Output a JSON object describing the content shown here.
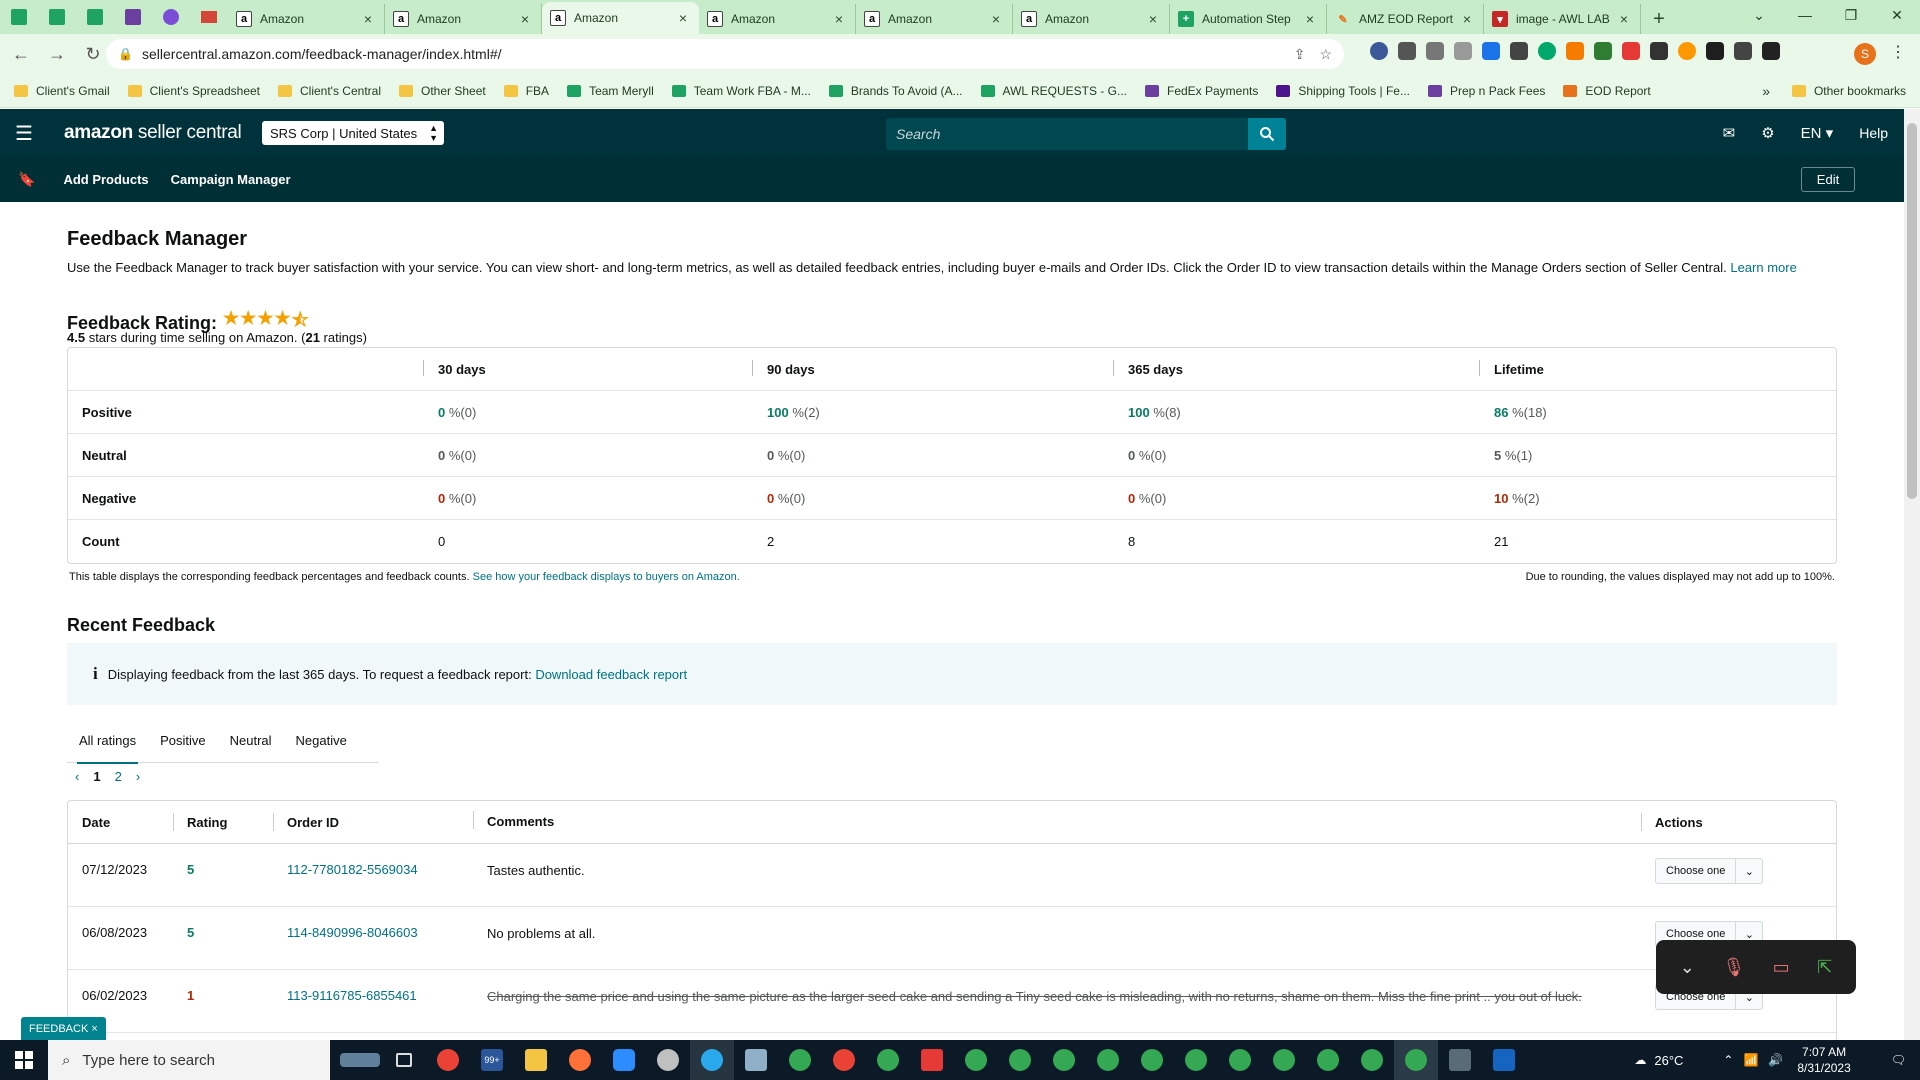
{
  "browser": {
    "tabs": [
      {
        "title": "Amazon",
        "icon": "amazon-icon",
        "active": false
      },
      {
        "title": "Amazon",
        "icon": "amazon-icon",
        "active": false
      },
      {
        "title": "Amazon",
        "icon": "amazon-icon",
        "active": true
      },
      {
        "title": "Amazon",
        "icon": "amazon-icon",
        "active": false
      },
      {
        "title": "Amazon",
        "icon": "amazon-icon",
        "active": false
      },
      {
        "title": "Amazon",
        "icon": "amazon-icon",
        "active": false
      },
      {
        "title": "Automation Step",
        "icon": "sheets-icon",
        "active": false
      },
      {
        "title": "AMZ EOD Report",
        "icon": "pen-icon",
        "active": false
      },
      {
        "title": "image - AWL LAB",
        "icon": "shield-icon",
        "active": false
      }
    ],
    "url": "sellercentral.amazon.com/feedback-manager/index.html#/",
    "bookmarks": [
      {
        "label": "Client's Gmail",
        "icon": "folder"
      },
      {
        "label": "Client's Spreadsheet",
        "icon": "folder"
      },
      {
        "label": "Client's Central",
        "icon": "folder"
      },
      {
        "label": "Other Sheet",
        "icon": "folder"
      },
      {
        "label": "FBA",
        "icon": "folder"
      },
      {
        "label": "Team Meryll",
        "icon": "sheet"
      },
      {
        "label": "Team Work FBA - M...",
        "icon": "sheet"
      },
      {
        "label": "Brands To Avoid (A...",
        "icon": "sheet"
      },
      {
        "label": "AWL REQUESTS - G...",
        "icon": "sheet"
      },
      {
        "label": "FedEx Payments",
        "icon": "purple"
      },
      {
        "label": "Shipping Tools | Fe...",
        "icon": "fedex"
      },
      {
        "label": "Prep n Pack Fees",
        "icon": "purple"
      },
      {
        "label": "EOD Report",
        "icon": "pen"
      }
    ],
    "bookmarks_more": "»",
    "other_bookmarks": "Other bookmarks",
    "profile_initial": "S"
  },
  "header": {
    "logo_main": "amazon",
    "logo_sub": " seller central",
    "account": "SRS Corp | United States",
    "search_placeholder": "Search",
    "language": "EN",
    "help": "Help"
  },
  "nav": {
    "links": [
      "Add Products",
      "Campaign Manager"
    ],
    "edit": "Edit"
  },
  "page": {
    "title": "Feedback Manager",
    "intro": "Use the Feedback Manager to track buyer satisfaction with your service. You can view short- and long-term metrics, as well as detailed feedback entries, including buyer e-mails and Order IDs. Click the Order ID to view transaction details within the Manage Orders section of Seller Central.",
    "learn_more": "Learn more",
    "rating_label": "Feedback Rating:",
    "rating_stars": 4.5,
    "rating_value": "4.5",
    "rating_text": " stars during time selling on Amazon. (",
    "rating_count": "21",
    "rating_suffix": " ratings)"
  },
  "summary": {
    "columns": [
      "30 days",
      "90 days",
      "365 days",
      "Lifetime"
    ],
    "rows": [
      {
        "label": "Positive",
        "type": "green",
        "cells": [
          {
            "n": "0",
            "s": " %(0)"
          },
          {
            "n": "100",
            "s": " %(2)"
          },
          {
            "n": "100",
            "s": " %(8)"
          },
          {
            "n": "86",
            "s": " %(18)"
          }
        ]
      },
      {
        "label": "Neutral",
        "type": "plain",
        "cells": [
          {
            "n": "0",
            "s": " %(0)"
          },
          {
            "n": "0",
            "s": " %(0)"
          },
          {
            "n": "0",
            "s": " %(0)"
          },
          {
            "n": "5",
            "s": " %(1)"
          }
        ]
      },
      {
        "label": "Negative",
        "type": "red",
        "cells": [
          {
            "n": "0",
            "s": " %(0)"
          },
          {
            "n": "0",
            "s": " %(0)"
          },
          {
            "n": "0",
            "s": " %(0)"
          },
          {
            "n": "10",
            "s": " %(2)"
          }
        ]
      },
      {
        "label": "Count",
        "type": "count",
        "cells": [
          {
            "n": "0",
            "s": ""
          },
          {
            "n": "2",
            "s": ""
          },
          {
            "n": "8",
            "s": ""
          },
          {
            "n": "21",
            "s": ""
          }
        ]
      }
    ],
    "note": "This table displays the corresponding feedback percentages and feedback counts.",
    "note_link": "See how your feedback displays to buyers on Amazon.",
    "rounding_note": "Due to rounding, the values displayed may not add up to 100%."
  },
  "recent": {
    "title": "Recent Feedback",
    "info": "Displaying feedback from the last 365 days. To request a feedback report:",
    "info_link": "Download feedback report",
    "tabs": [
      "All ratings",
      "Positive",
      "Neutral",
      "Negative"
    ],
    "active_tab": "All ratings",
    "pages": [
      "1",
      "2"
    ],
    "current_page": "1",
    "columns": [
      "Date",
      "Rating",
      "Order ID",
      "Comments",
      "Actions"
    ],
    "rows": [
      {
        "date": "07/12/2023",
        "rating": "5",
        "order": "112-7780182-5569034",
        "comment": "Tastes authentic.",
        "struck": false,
        "action": "Choose one"
      },
      {
        "date": "06/08/2023",
        "rating": "5",
        "order": "114-8490996-8046603",
        "comment": "No problems at all.",
        "struck": false,
        "action": "Choose one"
      },
      {
        "date": "06/02/2023",
        "rating": "1",
        "order": "113-9116785-6855461",
        "comment": "Charging the same price and using the same picture as the larger seed cake and sending a Tiny seed cake is misleading, with no returns, shame on them. Miss the fine print .. you out of luck.",
        "struck": true,
        "action": "Choose one"
      }
    ]
  },
  "feedback_tag": "FEEDBACK ×",
  "taskbar": {
    "search_placeholder": "Type here to search",
    "temperature": "26°C",
    "time": "7:07 AM",
    "date": "8/31/2023",
    "badge": "99+"
  },
  "colors": {
    "header_bg": "#00323c",
    "accent": "#007185",
    "positive": "#067d62",
    "negative": "#b12704"
  }
}
